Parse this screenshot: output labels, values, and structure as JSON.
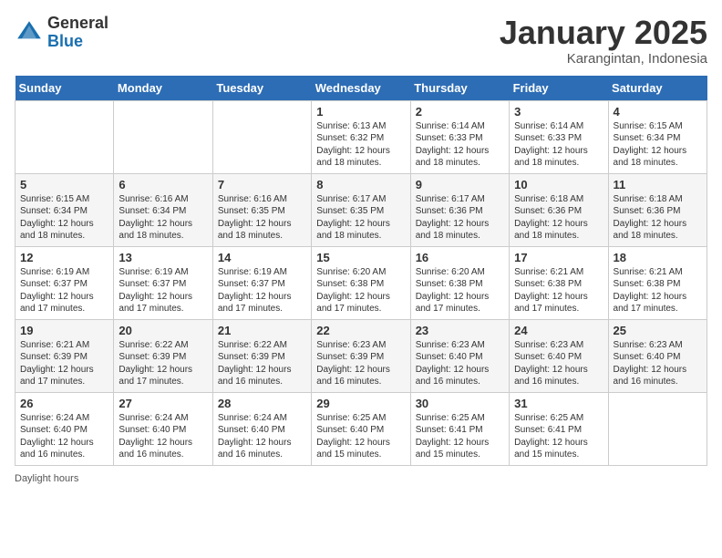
{
  "header": {
    "logo_general": "General",
    "logo_blue": "Blue",
    "title": "January 2025",
    "subtitle": "Karangintan, Indonesia"
  },
  "footer": {
    "daylight_label": "Daylight hours"
  },
  "days_of_week": [
    "Sunday",
    "Monday",
    "Tuesday",
    "Wednesday",
    "Thursday",
    "Friday",
    "Saturday"
  ],
  "weeks": [
    [
      {
        "day": "",
        "info": ""
      },
      {
        "day": "",
        "info": ""
      },
      {
        "day": "",
        "info": ""
      },
      {
        "day": "1",
        "info": "Sunrise: 6:13 AM\nSunset: 6:32 PM\nDaylight: 12 hours\nand 18 minutes."
      },
      {
        "day": "2",
        "info": "Sunrise: 6:14 AM\nSunset: 6:33 PM\nDaylight: 12 hours\nand 18 minutes."
      },
      {
        "day": "3",
        "info": "Sunrise: 6:14 AM\nSunset: 6:33 PM\nDaylight: 12 hours\nand 18 minutes."
      },
      {
        "day": "4",
        "info": "Sunrise: 6:15 AM\nSunset: 6:34 PM\nDaylight: 12 hours\nand 18 minutes."
      }
    ],
    [
      {
        "day": "5",
        "info": "Sunrise: 6:15 AM\nSunset: 6:34 PM\nDaylight: 12 hours\nand 18 minutes."
      },
      {
        "day": "6",
        "info": "Sunrise: 6:16 AM\nSunset: 6:34 PM\nDaylight: 12 hours\nand 18 minutes."
      },
      {
        "day": "7",
        "info": "Sunrise: 6:16 AM\nSunset: 6:35 PM\nDaylight: 12 hours\nand 18 minutes."
      },
      {
        "day": "8",
        "info": "Sunrise: 6:17 AM\nSunset: 6:35 PM\nDaylight: 12 hours\nand 18 minutes."
      },
      {
        "day": "9",
        "info": "Sunrise: 6:17 AM\nSunset: 6:36 PM\nDaylight: 12 hours\nand 18 minutes."
      },
      {
        "day": "10",
        "info": "Sunrise: 6:18 AM\nSunset: 6:36 PM\nDaylight: 12 hours\nand 18 minutes."
      },
      {
        "day": "11",
        "info": "Sunrise: 6:18 AM\nSunset: 6:36 PM\nDaylight: 12 hours\nand 18 minutes."
      }
    ],
    [
      {
        "day": "12",
        "info": "Sunrise: 6:19 AM\nSunset: 6:37 PM\nDaylight: 12 hours\nand 17 minutes."
      },
      {
        "day": "13",
        "info": "Sunrise: 6:19 AM\nSunset: 6:37 PM\nDaylight: 12 hours\nand 17 minutes."
      },
      {
        "day": "14",
        "info": "Sunrise: 6:19 AM\nSunset: 6:37 PM\nDaylight: 12 hours\nand 17 minutes."
      },
      {
        "day": "15",
        "info": "Sunrise: 6:20 AM\nSunset: 6:38 PM\nDaylight: 12 hours\nand 17 minutes."
      },
      {
        "day": "16",
        "info": "Sunrise: 6:20 AM\nSunset: 6:38 PM\nDaylight: 12 hours\nand 17 minutes."
      },
      {
        "day": "17",
        "info": "Sunrise: 6:21 AM\nSunset: 6:38 PM\nDaylight: 12 hours\nand 17 minutes."
      },
      {
        "day": "18",
        "info": "Sunrise: 6:21 AM\nSunset: 6:38 PM\nDaylight: 12 hours\nand 17 minutes."
      }
    ],
    [
      {
        "day": "19",
        "info": "Sunrise: 6:21 AM\nSunset: 6:39 PM\nDaylight: 12 hours\nand 17 minutes."
      },
      {
        "day": "20",
        "info": "Sunrise: 6:22 AM\nSunset: 6:39 PM\nDaylight: 12 hours\nand 17 minutes."
      },
      {
        "day": "21",
        "info": "Sunrise: 6:22 AM\nSunset: 6:39 PM\nDaylight: 12 hours\nand 16 minutes."
      },
      {
        "day": "22",
        "info": "Sunrise: 6:23 AM\nSunset: 6:39 PM\nDaylight: 12 hours\nand 16 minutes."
      },
      {
        "day": "23",
        "info": "Sunrise: 6:23 AM\nSunset: 6:40 PM\nDaylight: 12 hours\nand 16 minutes."
      },
      {
        "day": "24",
        "info": "Sunrise: 6:23 AM\nSunset: 6:40 PM\nDaylight: 12 hours\nand 16 minutes."
      },
      {
        "day": "25",
        "info": "Sunrise: 6:23 AM\nSunset: 6:40 PM\nDaylight: 12 hours\nand 16 minutes."
      }
    ],
    [
      {
        "day": "26",
        "info": "Sunrise: 6:24 AM\nSunset: 6:40 PM\nDaylight: 12 hours\nand 16 minutes."
      },
      {
        "day": "27",
        "info": "Sunrise: 6:24 AM\nSunset: 6:40 PM\nDaylight: 12 hours\nand 16 minutes."
      },
      {
        "day": "28",
        "info": "Sunrise: 6:24 AM\nSunset: 6:40 PM\nDaylight: 12 hours\nand 16 minutes."
      },
      {
        "day": "29",
        "info": "Sunrise: 6:25 AM\nSunset: 6:40 PM\nDaylight: 12 hours\nand 15 minutes."
      },
      {
        "day": "30",
        "info": "Sunrise: 6:25 AM\nSunset: 6:41 PM\nDaylight: 12 hours\nand 15 minutes."
      },
      {
        "day": "31",
        "info": "Sunrise: 6:25 AM\nSunset: 6:41 PM\nDaylight: 12 hours\nand 15 minutes."
      },
      {
        "day": "",
        "info": ""
      }
    ]
  ]
}
